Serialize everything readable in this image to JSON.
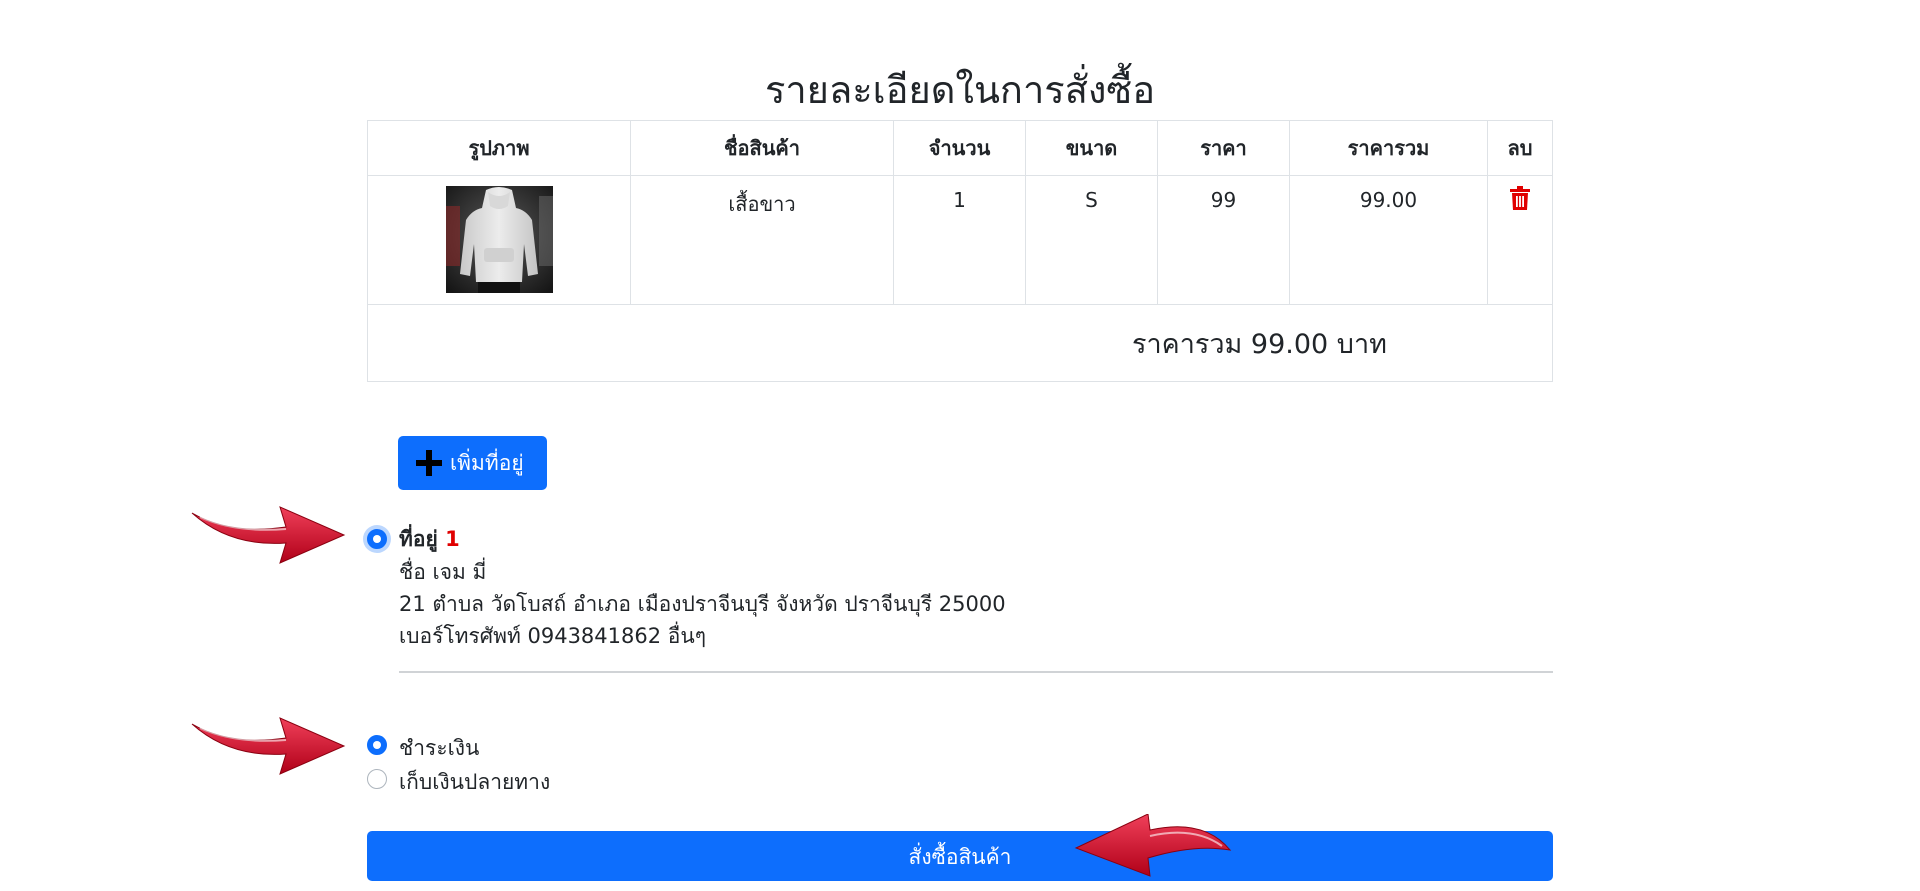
{
  "page": {
    "title": "รายละเอียดในการสั่งซื้อ"
  },
  "cart": {
    "headers": [
      "รูปภาพ",
      "ชื่อสินค้า",
      "จำนวน",
      "ขนาด",
      "ราคา",
      "ราคารวม",
      "ลบ"
    ],
    "items": [
      {
        "image": "product-photo",
        "name": "เสื้อขาว",
        "quantity": "1",
        "size": "S",
        "price": "99",
        "line_total": "99.00",
        "delete_icon": "trash-icon"
      }
    ],
    "total_text": "ราคารวม 99.00 บาท"
  },
  "address": {
    "add_button_label": "เพิ่มที่อยู่",
    "add_button_icon": "plus-icon",
    "title_label": "ที่อยู่",
    "title_number": "1",
    "name_line": "ชื่อ เจม มี่",
    "address_line": "21 ตำบล วัดโบสถ์ อำเภอ เมืองปราจีนบุรี จังหวัด ปราจีนบุรี 25000",
    "phone_line": "เบอร์โทรศัพท์ 0943841862 อื่นๆ",
    "selected": true
  },
  "payment": {
    "options": [
      {
        "label": "ชำระเงิน",
        "selected": true
      },
      {
        "label": "เก็บเงินปลายทาง",
        "selected": false
      }
    ]
  },
  "order_button_label": "สั่งซื้อสินค้า",
  "colors": {
    "primary": "#0d6efd",
    "danger": "#e00000",
    "annotation_arrow": "#d8102a"
  },
  "annotations": [
    "arrow-icon",
    "arrow-icon",
    "arrow-icon"
  ]
}
